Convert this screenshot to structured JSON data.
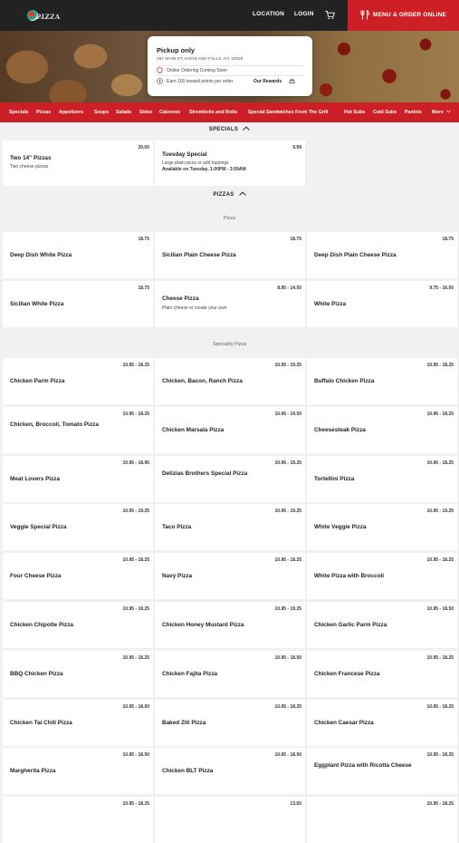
{
  "header": {
    "logo_text": "PIZZA",
    "logo_sub": "DELIZIAS",
    "location_label": "LOCATION",
    "login_label": "LOGIN",
    "order_label": "MENU & ORDER ONLINE",
    "accent_color": "#cc1f26",
    "icons": [
      "cart-icon",
      "utensils-icon"
    ]
  },
  "info_card": {
    "title": "Pickup only",
    "address": "287 MAIN ST, HIGHLAND FALLS, NY 10928",
    "online_ordering": "Online Ordering Coming Soon",
    "reward_points": "Earn 100 reward points per order",
    "rewards_link": "Our Rewards"
  },
  "categories": [
    "Specials",
    "Pizzas",
    "Appetizers",
    "Soups",
    "Salads",
    "Sides",
    "Calzones",
    "Strombolis and Rolls",
    "Special Sandwiches From The Grill",
    "Hot Subs",
    "Cold Subs",
    "Paninis",
    "More"
  ],
  "specials": {
    "heading": "SPECIALS",
    "items": [
      {
        "name": "Two 14\" Pizzas",
        "desc": "Two cheese pizzas",
        "price": "20.00"
      },
      {
        "name": "Tuesday Special",
        "desc": "Large plain pizza or add toppings",
        "note": "Available on Tuesday, 1:00PM - 3:59AM",
        "price": "9.99"
      }
    ]
  },
  "pizzas": {
    "heading": "PIZZAS",
    "pizza_sub": "Pizza",
    "specialty_sub": "Speciality Pizza",
    "pizza_items": [
      {
        "name": "Deep Dish White Pizza",
        "price": "18.75",
        "desc": ""
      },
      {
        "name": "Sicilian Plain Cheese Pizza",
        "price": "18.75",
        "desc": ""
      },
      {
        "name": "Deep Dish Plain Cheese Pizza",
        "price": "18.75",
        "desc": ""
      },
      {
        "name": "Sicilian White Pizza",
        "price": "18.75",
        "desc": ""
      },
      {
        "name": "Cheese Pizza",
        "price": "8.95 - 14.50",
        "desc": "Plain cheese or create your own"
      },
      {
        "name": "White Pizza",
        "price": "9.75 - 16.50",
        "desc": ""
      }
    ],
    "specialty_items": [
      {
        "name": "Chicken Parm Pizza",
        "price": "10.95 - 18.25"
      },
      {
        "name": "Chicken, Bacon, Ranch Pizza",
        "price": "10.95 - 19.25"
      },
      {
        "name": "Buffalo Chicken Pizza",
        "price": "10.95 - 18.25"
      },
      {
        "name": "Chicken, Broccoli, Tomato Pizza",
        "price": "10.95 - 18.25"
      },
      {
        "name": "Chicken Marsala Pizza",
        "price": "10.95 - 19.50"
      },
      {
        "name": "Cheesesteak Pizza",
        "price": "10.95 - 18.25"
      },
      {
        "name": "Meat Lovers Pizza",
        "price": "10.95 - 18.95"
      },
      {
        "name": "Delizias Brothers Special Pizza",
        "price": "10.95 - 19.25"
      },
      {
        "name": "Tortellini Pizza",
        "price": "10.95 - 18.25"
      },
      {
        "name": "Veggie Special Pizza",
        "price": "10.95 - 19.25"
      },
      {
        "name": "Taco Pizza",
        "price": "10.95 - 19.25"
      },
      {
        "name": "White Veggie Pizza",
        "price": "10.95 - 19.25"
      },
      {
        "name": "Four Cheese Pizza",
        "price": "10.95 - 18.25"
      },
      {
        "name": "Navy Pizza",
        "price": "10.95 - 18.25"
      },
      {
        "name": "White Pizza with Broccoli",
        "price": "10.95 - 18.25"
      },
      {
        "name": "Chicken Chipotle Pizza",
        "price": "10.95 - 18.25"
      },
      {
        "name": "Chicken Honey Mustard Pizza",
        "price": "10.95 - 19.25"
      },
      {
        "name": "Chicken Garlic Parm Pizza",
        "price": "10.95 - 18.50"
      },
      {
        "name": "BBQ Chicken Pizza",
        "price": "10.95 - 18.25"
      },
      {
        "name": "Chicken Fajita Pizza",
        "price": "10.95 - 18.50"
      },
      {
        "name": "Chicken Francese Pizza",
        "price": "10.95 - 18.25"
      },
      {
        "name": "Chicken Tai Chili Pizza",
        "price": "10.95 - 18.50"
      },
      {
        "name": "Baked Ziti Pizza",
        "price": "10.95 - 18.25"
      },
      {
        "name": "Chicken Caesar Pizza",
        "price": "10.95 - 18.25"
      },
      {
        "name": "Margherita Pizza",
        "price": "10.95 - 18.50"
      },
      {
        "name": "Chicken BLT Pizza",
        "price": "10.95 - 18.50"
      },
      {
        "name": "Eggplant Pizza with Ricotta Cheese",
        "price": "10.95 - 18.25"
      },
      {
        "name": "",
        "price": "10.95 - 18.25"
      },
      {
        "name": "",
        "price": "13.50"
      },
      {
        "name": "",
        "price": "10.95 - 18.25"
      }
    ]
  }
}
